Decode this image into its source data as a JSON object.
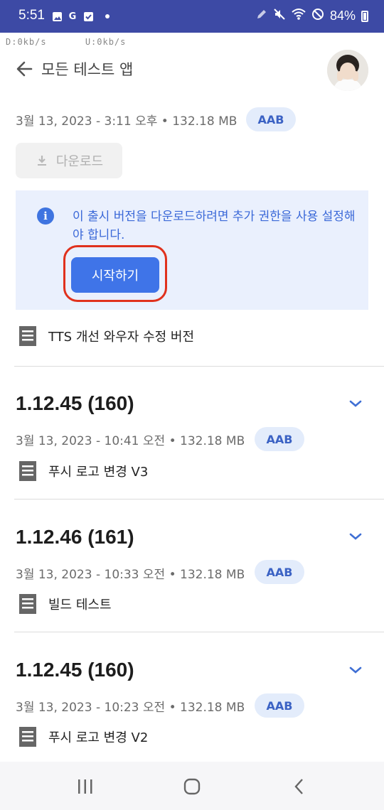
{
  "status_bar": {
    "time": "5:51",
    "battery": "84%",
    "left_icons": [
      "gallery-icon",
      "google-icon",
      "checkbox-icon"
    ],
    "right_icons": [
      "pen-icon",
      "mute-icon",
      "wifi-icon",
      "do-not-disturb-icon",
      "battery-icon"
    ]
  },
  "netspeed": {
    "down": "D:0kb/s",
    "up": "U:0kb/s"
  },
  "appbar": {
    "title": "모든 테스트 앱"
  },
  "release": {
    "meta": "3월 13, 2023 - 3:11 오후 • 132.18 MB",
    "badge": "AAB",
    "download_label": "다운로드",
    "info_text": "이 출시 버전을 다운로드하려면 추가 권한을 사용 설정해야 합니다.",
    "start_label": "시작하기",
    "note": "TTS 개선 와우자 수정 버전"
  },
  "versions": [
    {
      "title": "1.12.45 (160)",
      "meta": "3월 13, 2023 - 10:41 오전 • 132.18 MB",
      "badge": "AAB",
      "note": "푸시 로고 변경 V3"
    },
    {
      "title": "1.12.46 (161)",
      "meta": "3월 13, 2023 - 10:33 오전 • 132.18 MB",
      "badge": "AAB",
      "note": "빌드 테스트"
    },
    {
      "title": "1.12.45 (160)",
      "meta": "3월 13, 2023 - 10:23 오전 • 132.18 MB",
      "badge": "AAB",
      "note": "푸시 로고 변경 V2"
    }
  ],
  "colors": {
    "status_bar": "#3d4aa5",
    "accent": "#3f74e8",
    "highlight": "#e0311d",
    "info_bg": "#eaf0fd"
  }
}
